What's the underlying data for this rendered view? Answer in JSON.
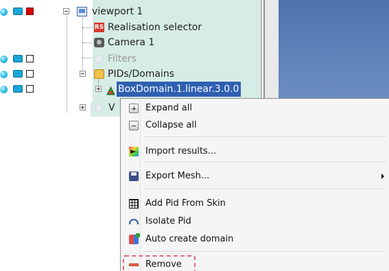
{
  "tree": {
    "viewport_label": "viewport 1",
    "realisation_label": "Realisation selector",
    "camera_label": "Camera 1",
    "filters_label": "Filters",
    "pids_label": "PIDs/Domains",
    "boxdomain_label": "BoxDomain.1.linear.3.0.0",
    "v_label": "V"
  },
  "context_menu": {
    "expand_all": "Expand all",
    "collapse_all": "Collapse all",
    "import_results": "Import results...",
    "export_mesh": "Export Mesh...",
    "add_pid_from_skin": "Add Pid From Skin",
    "isolate_pid": "Isolate Pid",
    "auto_create_domain": "Auto create domain",
    "remove": "Remove"
  },
  "colors": {
    "tree_highlight": "#d6ece6",
    "selection": "#2f5fb2",
    "remove_outline": "#e16a74"
  }
}
